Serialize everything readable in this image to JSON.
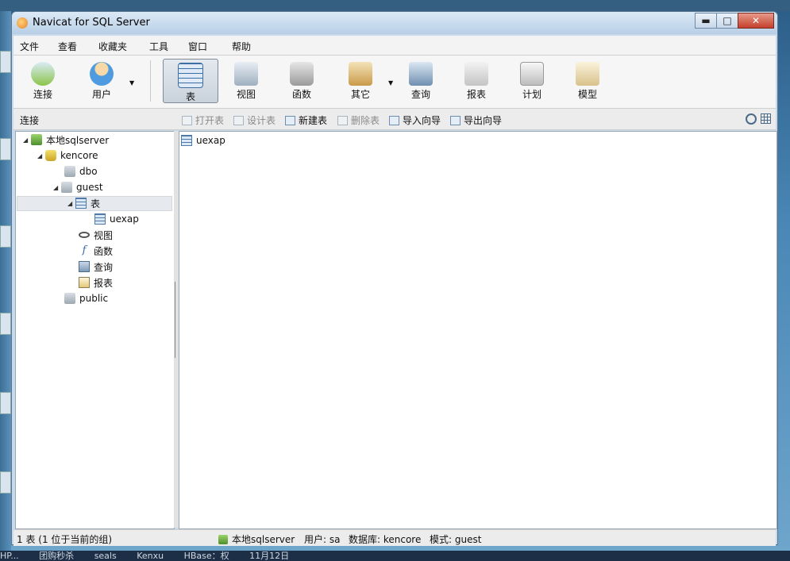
{
  "window": {
    "title": "Navicat for SQL Server",
    "minimize": "▬",
    "maximize": "□",
    "close": "✕"
  },
  "menu": [
    "文件",
    "查看",
    "收藏夹",
    "工具",
    "窗口",
    "帮助"
  ],
  "toolbar": {
    "buttons": [
      {
        "label": "连接",
        "icon": "connect-icon"
      },
      {
        "label": "用户",
        "icon": "user-icon"
      },
      {
        "label": "表",
        "icon": "table-icon"
      },
      {
        "label": "视图",
        "icon": "view-icon"
      },
      {
        "label": "函数",
        "icon": "function-icon"
      },
      {
        "label": "其它",
        "icon": "other-icon"
      },
      {
        "label": "查询",
        "icon": "query-icon"
      },
      {
        "label": "报表",
        "icon": "report-icon"
      },
      {
        "label": "计划",
        "icon": "schedule-icon"
      },
      {
        "label": "模型",
        "icon": "model-icon"
      }
    ],
    "active": "表"
  },
  "subbar": {
    "title": "连接",
    "actions": [
      {
        "label": "打开表",
        "enabled": false
      },
      {
        "label": "设计表",
        "enabled": false
      },
      {
        "label": "新建表",
        "enabled": true
      },
      {
        "label": "删除表",
        "enabled": false
      },
      {
        "label": "导入向导",
        "enabled": true
      },
      {
        "label": "导出向导",
        "enabled": true
      }
    ]
  },
  "tree": {
    "server": "本地sqlserver",
    "database": "kencore",
    "schemas": {
      "dbo": "dbo",
      "guest": "guest",
      "public": "public"
    },
    "guest_children": {
      "tables": "表",
      "table_item": "uexap",
      "views": "视图",
      "functions": "函数",
      "queries": "查询",
      "reports": "报表"
    }
  },
  "objects": [
    "uexap"
  ],
  "status": {
    "left": "1 表 (1 位于当前的组)",
    "server": "本地sqlserver",
    "user": "用户: sa",
    "database": "数据库: kencore",
    "schema": "模式: guest"
  },
  "taskbar": [
    "HP...",
    "团购秒杀",
    "seals",
    "Kenxu",
    "HBase：权",
    "11月12日"
  ]
}
